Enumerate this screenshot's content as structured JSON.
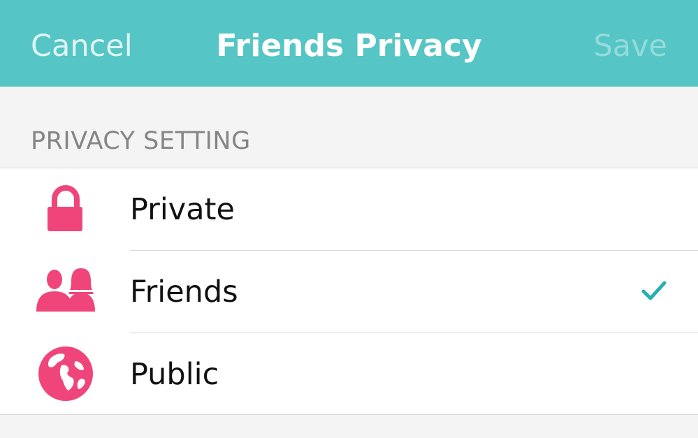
{
  "colors": {
    "nav_background": "#55c5c5",
    "icon_pink": "#f0457a",
    "check_teal": "#22b0b4"
  },
  "navbar": {
    "cancel_label": "Cancel",
    "title": "Friends Privacy",
    "save_label": "Save"
  },
  "section": {
    "header": "PRIVACY SETTING"
  },
  "options": [
    {
      "label": "Private",
      "icon": "lock-icon",
      "selected": false
    },
    {
      "label": "Friends",
      "icon": "friends-icon",
      "selected": true
    },
    {
      "label": "Public",
      "icon": "globe-icon",
      "selected": false
    }
  ]
}
